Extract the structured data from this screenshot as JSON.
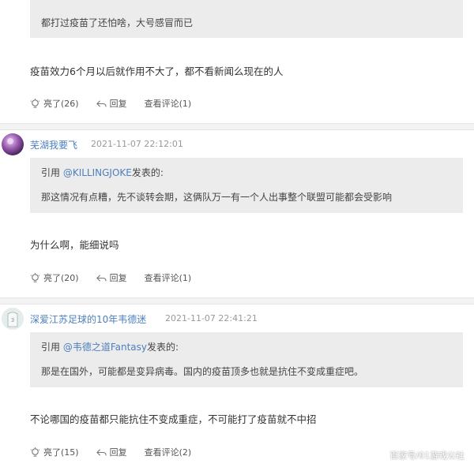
{
  "top_partial": {
    "quote_body": "都打过疫苗了还怕啥，大号感冒而已",
    "reply_text": "疫苗效力6个月以后就作用不大了，都不看新闻么现在的人",
    "actions": {
      "like": "亮了(26)",
      "reply": "回复",
      "view": "查看评论(1)"
    }
  },
  "comments": [
    {
      "username": "芜湖我要飞",
      "time": "2021-11-07 22:12:01",
      "quote_prefix": "引用 ",
      "quote_user": "@KILLINGJOKE",
      "quote_suffix": "发表的:",
      "quote_body": "那这情况有点糟，先不谈转会期，这俩队万一有一个人出事整个联盟可能都会受影响",
      "reply_text": "为什么啊，能细说吗",
      "actions": {
        "like": "亮了(20)",
        "reply": "回复",
        "view": "查看评论(1)"
      }
    },
    {
      "username": "深爱江苏足球的10年韦德迷",
      "time": "2021-11-07 22:41:21",
      "quote_prefix": "引用 ",
      "quote_user": "@韦德之道Fantasy",
      "quote_suffix": "发表的:",
      "quote_body": "那是在国外，可能都是变异病毒。国内的疫苗顶多也就是抗住不变成重症吧。",
      "reply_text": "不论哪国的疫苗都只能抗住不变成重症，不可能打了疫苗就不中招",
      "actions": {
        "like": "亮了(15)",
        "reply": "回复",
        "view": "查看评论(2)"
      }
    }
  ],
  "watermark": "百家号/01游戏公社",
  "colors": {
    "link": "#4d7fbd",
    "quote_bg": "#ececec",
    "divider": "#f3f3f3"
  }
}
